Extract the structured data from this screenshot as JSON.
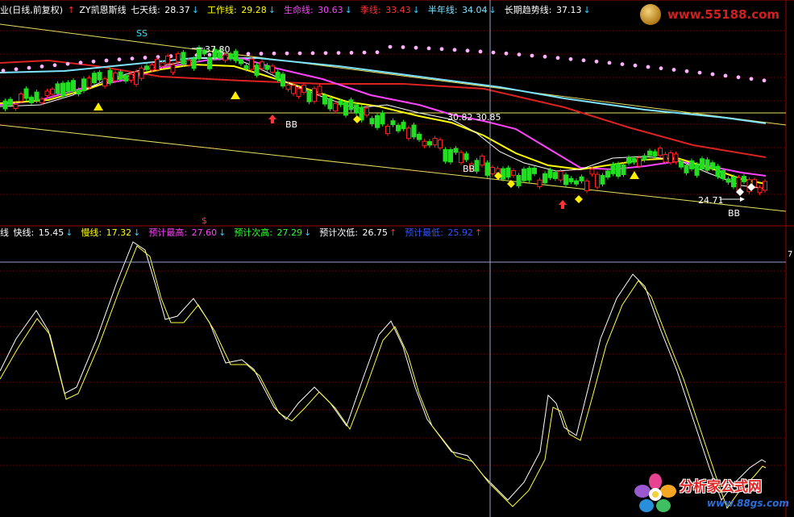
{
  "top_header": {
    "title": "业(日线,前复权)",
    "indicator": "ZY凯恩斯线",
    "items": [
      {
        "label": "七天线:",
        "value": "28.37",
        "arrow": "↓",
        "color": "#ffffff"
      },
      {
        "label": "工作线:",
        "value": "29.28",
        "arrow": "↓",
        "color": "#ffff00"
      },
      {
        "label": "生命线:",
        "value": "30.63",
        "arrow": "↓",
        "color": "#ff44ff"
      },
      {
        "label": "季线:",
        "value": "33.43",
        "arrow": "↓",
        "color": "#ff3333"
      },
      {
        "label": "半年线:",
        "value": "34.04",
        "arrow": "↓",
        "color": "#7fe3ff"
      },
      {
        "label": "长期趋势线:",
        "value": "37.13",
        "arrow": "↓",
        "color": "#ffffff"
      }
    ]
  },
  "bottom_header": {
    "title": "线",
    "items": [
      {
        "label": "快线:",
        "value": "15.45",
        "arrow": "↓",
        "color": "#ffffff"
      },
      {
        "label": "慢线:",
        "value": "17.32",
        "arrow": "↓",
        "color": "#ffff00"
      },
      {
        "label": "预计最高:",
        "value": "27.60",
        "arrow": "↓",
        "color": "#ff44ff"
      },
      {
        "label": "预计次高:",
        "value": "27.29",
        "arrow": "↓",
        "color": "#33ff33"
      },
      {
        "label": "预计次低:",
        "value": "26.75",
        "arrow": "↑",
        "color": "#ffffff"
      },
      {
        "label": "预计最低:",
        "value": "25.92",
        "arrow": "↑",
        "color": "#3355ff"
      }
    ]
  },
  "annotations": {
    "ss": "SS",
    "high_label": "37.80",
    "bb1": "BB",
    "bb2": "BB",
    "bb3": "BB",
    "mid_label": "30.82  30.85",
    "low_label": "24.71",
    "dollar": "$",
    "right_edge": "7"
  },
  "watermarks": {
    "top_url": "www.55188.com",
    "bottom_cn": "分析家公式网",
    "bottom_url": "www.88gs.com"
  },
  "colors": {
    "background": "#000000",
    "divider": "#a00000",
    "crosshair": "#9aa0c8",
    "fast_line": "#ffffff",
    "slow_line": "#ffff44",
    "seven_day": "#ffffff",
    "work_line": "#ffff00",
    "life_line": "#ff44ff",
    "season_line": "#dd2222",
    "half_year": "#7fe3ff",
    "long_trend": "#ffb0ff"
  }
}
